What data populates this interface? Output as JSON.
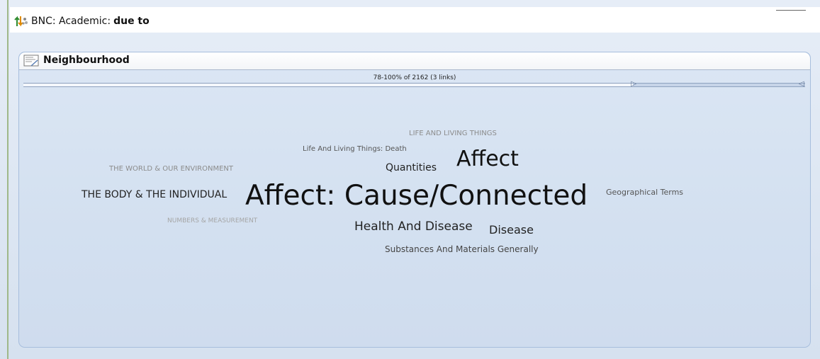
{
  "window": {
    "title_prefix": "BNC: Academic:",
    "query": "due to"
  },
  "panel": {
    "title": "Neighbourhood",
    "range_label": "78-100% of 2162 (3 links)",
    "slider": {
      "lower_fraction": 0.78,
      "upper_fraction": 1.0
    }
  },
  "icons": {
    "title_icon": "sort-arrows-icon",
    "panel_icon": "document-chart-icon",
    "slider_handle": "slider-handle-icon"
  },
  "colors": {
    "background": "#dde6f2",
    "panel_border": "#a7bedd",
    "word_dark": "#111111",
    "word_mid": "#444444",
    "word_light": "#9a9a9a"
  },
  "cloud": {
    "words": [
      "LIFE AND LIVING THINGS",
      "Life And Living Things: Death",
      "THE WORLD & OUR ENVIRONMENT",
      "Quantities",
      "Affect",
      "THE BODY & THE INDIVIDUAL",
      "Affect: Cause/Connected",
      "Geographical Terms",
      "NUMBERS & MEASUREMENT",
      "Health And Disease",
      "Disease",
      "Substances And Materials Generally"
    ]
  }
}
